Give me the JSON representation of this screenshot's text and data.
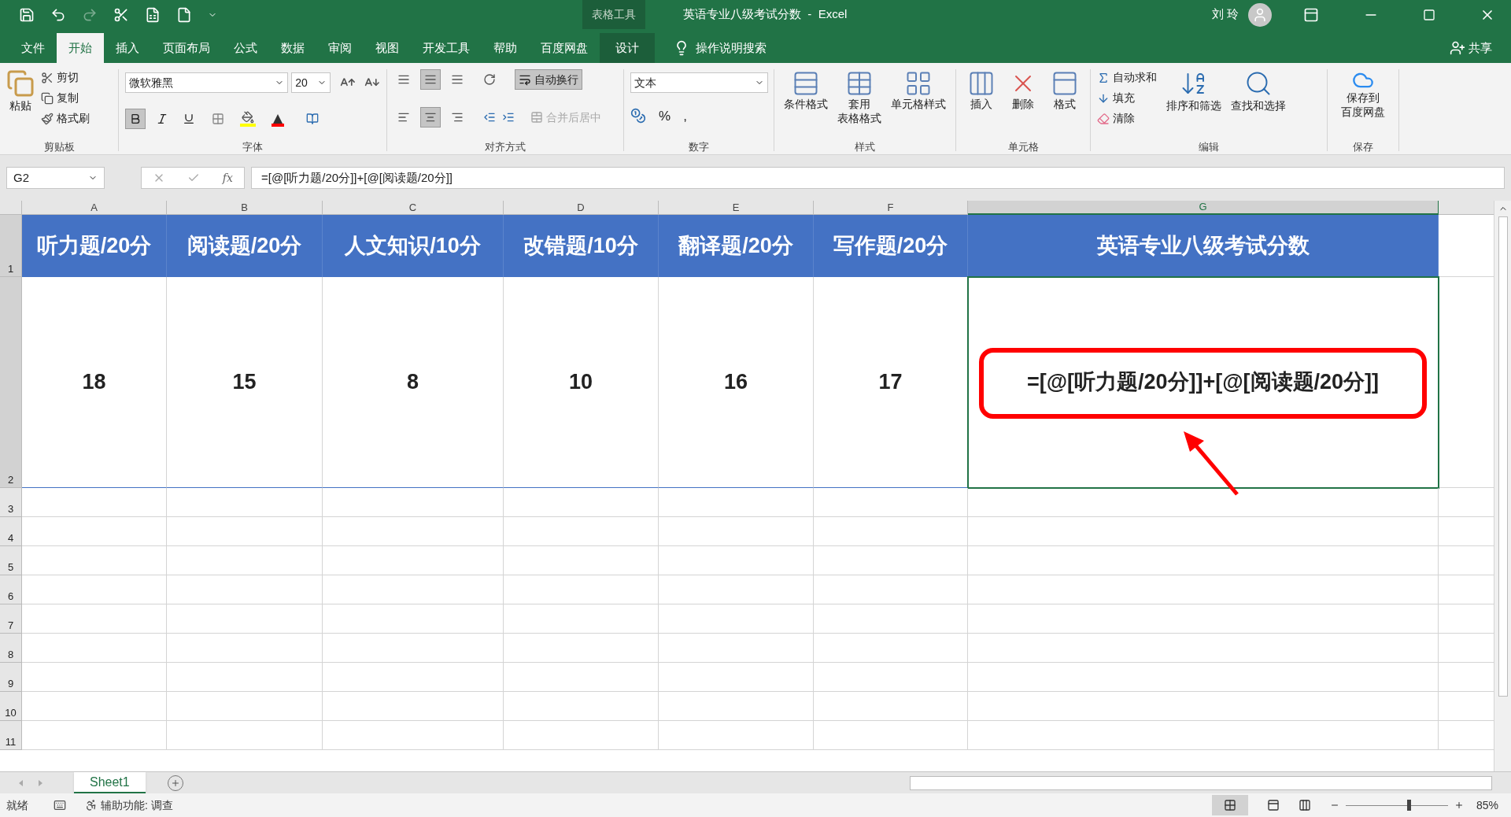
{
  "title_bar": {
    "context_label": "表格工具",
    "title": "英语专业八级考试分数  -  Excel",
    "user": "刘 玲"
  },
  "tabs": [
    {
      "label": "文件",
      "selected": false
    },
    {
      "label": "开始",
      "selected": true
    },
    {
      "label": "插入",
      "selected": false
    },
    {
      "label": "页面布局",
      "selected": false
    },
    {
      "label": "公式",
      "selected": false
    },
    {
      "label": "数据",
      "selected": false
    },
    {
      "label": "审阅",
      "selected": false
    },
    {
      "label": "视图",
      "selected": false
    },
    {
      "label": "开发工具",
      "selected": false
    },
    {
      "label": "帮助",
      "selected": false
    },
    {
      "label": "百度网盘",
      "selected": false
    },
    {
      "label": "设计",
      "selected": false,
      "kind": "contextual"
    }
  ],
  "tell_me": "操作说明搜索",
  "share": "共享",
  "clipboard": {
    "paste": "粘贴",
    "items": [
      {
        "kind": "cut",
        "label": "剪切"
      },
      {
        "kind": "copy",
        "label": "复制"
      },
      {
        "kind": "painter",
        "label": "格式刷"
      }
    ],
    "label": "剪贴板"
  },
  "font": {
    "name": "微软雅黑",
    "size": "20",
    "toggles": [
      {
        "kind": "bold",
        "on": true
      },
      {
        "kind": "italic",
        "on": false
      },
      {
        "kind": "underline",
        "on": false
      }
    ],
    "label": "字体"
  },
  "alignment": {
    "vertical": [
      {
        "selected": false
      },
      {
        "selected": true
      },
      {
        "selected": false
      }
    ],
    "horizontal": [
      {
        "selected": false
      },
      {
        "selected": true
      },
      {
        "selected": false
      }
    ],
    "wrap": {
      "label": "自动换行",
      "on": true
    },
    "merge": {
      "label": "合并后居中",
      "disabled": true
    },
    "label": "对齐方式"
  },
  "number": {
    "format": "文本",
    "symbols": [
      "%",
      ","
    ],
    "label": "数字"
  },
  "styles": {
    "buttons": [
      {
        "kind": "conditional",
        "label": [
          "条件格式"
        ]
      },
      {
        "kind": "table",
        "label": [
          "套用",
          "表格格式"
        ]
      },
      {
        "kind": "cellstyle",
        "label": [
          "单元格样式"
        ]
      }
    ],
    "label": "样式"
  },
  "cells": {
    "buttons": [
      {
        "kind": "insert",
        "label": [
          "插入"
        ]
      },
      {
        "kind": "delete",
        "label": [
          "删除"
        ]
      },
      {
        "kind": "format",
        "label": [
          "格式"
        ]
      }
    ],
    "label": "单元格"
  },
  "editing": {
    "small": [
      {
        "kind": "sum",
        "label": "自动求和"
      },
      {
        "kind": "fill",
        "label": "填充"
      },
      {
        "kind": "clear",
        "label": "清除"
      }
    ],
    "buttons": [
      {
        "kind": "sort",
        "label": "排序和筛选"
      },
      {
        "kind": "find",
        "label": "查找和选择"
      }
    ],
    "label": "编辑"
  },
  "save": {
    "button": [
      "保存到",
      "百度网盘"
    ],
    "label": "保存"
  },
  "formula_bar": {
    "name_box": "G2",
    "fx": "fx",
    "formula": "=[@[听力题/20分]]+[@[阅读题/20分]]"
  },
  "columns": [
    {
      "letter": "A",
      "selected": false
    },
    {
      "letter": "B",
      "selected": false
    },
    {
      "letter": "C",
      "selected": false
    },
    {
      "letter": "D",
      "selected": false
    },
    {
      "letter": "E",
      "selected": false
    },
    {
      "letter": "F",
      "selected": false
    },
    {
      "letter": "G",
      "selected": true
    }
  ],
  "rows": [
    {
      "number": "1",
      "cells": [
        {
          "text": "听力题/20分",
          "selected": false
        },
        {
          "text": "阅读题/20分",
          "selected": false
        },
        {
          "text": "人文知识/10分",
          "selected": false
        },
        {
          "text": "改错题/10分",
          "selected": false
        },
        {
          "text": "翻译题/20分",
          "selected": false
        },
        {
          "text": "写作题/20分",
          "selected": false
        },
        {
          "text": "英语专业八级考试分数",
          "selected": false
        }
      ]
    },
    {
      "number": "2",
      "cells": [
        {
          "text": "18",
          "selected": false
        },
        {
          "text": "15",
          "selected": false
        },
        {
          "text": "8",
          "selected": false
        },
        {
          "text": "10",
          "selected": false
        },
        {
          "text": "16",
          "selected": false
        },
        {
          "text": "17",
          "selected": false
        },
        {
          "text": "=[@[听力题/20分]]+[@[阅读题/20分]]",
          "selected": true
        }
      ]
    },
    {
      "number": "3"
    },
    {
      "number": "4"
    },
    {
      "number": "5"
    },
    {
      "number": "6"
    },
    {
      "number": "7"
    },
    {
      "number": "8"
    },
    {
      "number": "9"
    },
    {
      "number": "10"
    },
    {
      "number": "11"
    }
  ],
  "sheet_tabs": [
    {
      "label": "Sheet1",
      "selected": true
    }
  ],
  "status_bar": {
    "ready": "就绪",
    "accessibility": "辅助功能: 调查",
    "zoom": "85%",
    "level": 0.6
  }
}
